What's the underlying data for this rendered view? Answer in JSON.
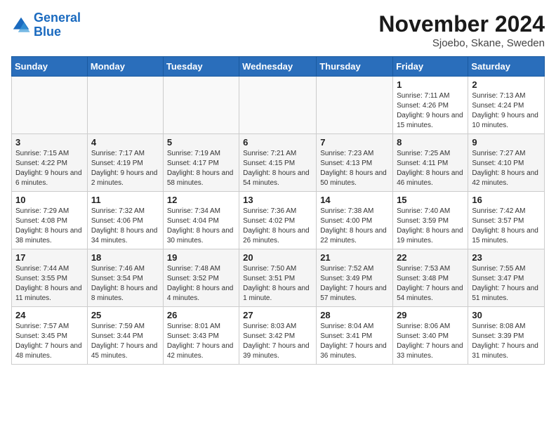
{
  "logo": {
    "line1": "General",
    "line2": "Blue"
  },
  "title": "November 2024",
  "location": "Sjoebo, Skane, Sweden",
  "days_of_week": [
    "Sunday",
    "Monday",
    "Tuesday",
    "Wednesday",
    "Thursday",
    "Friday",
    "Saturday"
  ],
  "weeks": [
    [
      {
        "day": "",
        "info": ""
      },
      {
        "day": "",
        "info": ""
      },
      {
        "day": "",
        "info": ""
      },
      {
        "day": "",
        "info": ""
      },
      {
        "day": "",
        "info": ""
      },
      {
        "day": "1",
        "info": "Sunrise: 7:11 AM\nSunset: 4:26 PM\nDaylight: 9 hours and 15 minutes."
      },
      {
        "day": "2",
        "info": "Sunrise: 7:13 AM\nSunset: 4:24 PM\nDaylight: 9 hours and 10 minutes."
      }
    ],
    [
      {
        "day": "3",
        "info": "Sunrise: 7:15 AM\nSunset: 4:22 PM\nDaylight: 9 hours and 6 minutes."
      },
      {
        "day": "4",
        "info": "Sunrise: 7:17 AM\nSunset: 4:19 PM\nDaylight: 9 hours and 2 minutes."
      },
      {
        "day": "5",
        "info": "Sunrise: 7:19 AM\nSunset: 4:17 PM\nDaylight: 8 hours and 58 minutes."
      },
      {
        "day": "6",
        "info": "Sunrise: 7:21 AM\nSunset: 4:15 PM\nDaylight: 8 hours and 54 minutes."
      },
      {
        "day": "7",
        "info": "Sunrise: 7:23 AM\nSunset: 4:13 PM\nDaylight: 8 hours and 50 minutes."
      },
      {
        "day": "8",
        "info": "Sunrise: 7:25 AM\nSunset: 4:11 PM\nDaylight: 8 hours and 46 minutes."
      },
      {
        "day": "9",
        "info": "Sunrise: 7:27 AM\nSunset: 4:10 PM\nDaylight: 8 hours and 42 minutes."
      }
    ],
    [
      {
        "day": "10",
        "info": "Sunrise: 7:29 AM\nSunset: 4:08 PM\nDaylight: 8 hours and 38 minutes."
      },
      {
        "day": "11",
        "info": "Sunrise: 7:32 AM\nSunset: 4:06 PM\nDaylight: 8 hours and 34 minutes."
      },
      {
        "day": "12",
        "info": "Sunrise: 7:34 AM\nSunset: 4:04 PM\nDaylight: 8 hours and 30 minutes."
      },
      {
        "day": "13",
        "info": "Sunrise: 7:36 AM\nSunset: 4:02 PM\nDaylight: 8 hours and 26 minutes."
      },
      {
        "day": "14",
        "info": "Sunrise: 7:38 AM\nSunset: 4:00 PM\nDaylight: 8 hours and 22 minutes."
      },
      {
        "day": "15",
        "info": "Sunrise: 7:40 AM\nSunset: 3:59 PM\nDaylight: 8 hours and 19 minutes."
      },
      {
        "day": "16",
        "info": "Sunrise: 7:42 AM\nSunset: 3:57 PM\nDaylight: 8 hours and 15 minutes."
      }
    ],
    [
      {
        "day": "17",
        "info": "Sunrise: 7:44 AM\nSunset: 3:55 PM\nDaylight: 8 hours and 11 minutes."
      },
      {
        "day": "18",
        "info": "Sunrise: 7:46 AM\nSunset: 3:54 PM\nDaylight: 8 hours and 8 minutes."
      },
      {
        "day": "19",
        "info": "Sunrise: 7:48 AM\nSunset: 3:52 PM\nDaylight: 8 hours and 4 minutes."
      },
      {
        "day": "20",
        "info": "Sunrise: 7:50 AM\nSunset: 3:51 PM\nDaylight: 8 hours and 1 minute."
      },
      {
        "day": "21",
        "info": "Sunrise: 7:52 AM\nSunset: 3:49 PM\nDaylight: 7 hours and 57 minutes."
      },
      {
        "day": "22",
        "info": "Sunrise: 7:53 AM\nSunset: 3:48 PM\nDaylight: 7 hours and 54 minutes."
      },
      {
        "day": "23",
        "info": "Sunrise: 7:55 AM\nSunset: 3:47 PM\nDaylight: 7 hours and 51 minutes."
      }
    ],
    [
      {
        "day": "24",
        "info": "Sunrise: 7:57 AM\nSunset: 3:45 PM\nDaylight: 7 hours and 48 minutes."
      },
      {
        "day": "25",
        "info": "Sunrise: 7:59 AM\nSunset: 3:44 PM\nDaylight: 7 hours and 45 minutes."
      },
      {
        "day": "26",
        "info": "Sunrise: 8:01 AM\nSunset: 3:43 PM\nDaylight: 7 hours and 42 minutes."
      },
      {
        "day": "27",
        "info": "Sunrise: 8:03 AM\nSunset: 3:42 PM\nDaylight: 7 hours and 39 minutes."
      },
      {
        "day": "28",
        "info": "Sunrise: 8:04 AM\nSunset: 3:41 PM\nDaylight: 7 hours and 36 minutes."
      },
      {
        "day": "29",
        "info": "Sunrise: 8:06 AM\nSunset: 3:40 PM\nDaylight: 7 hours and 33 minutes."
      },
      {
        "day": "30",
        "info": "Sunrise: 8:08 AM\nSunset: 3:39 PM\nDaylight: 7 hours and 31 minutes."
      }
    ]
  ]
}
